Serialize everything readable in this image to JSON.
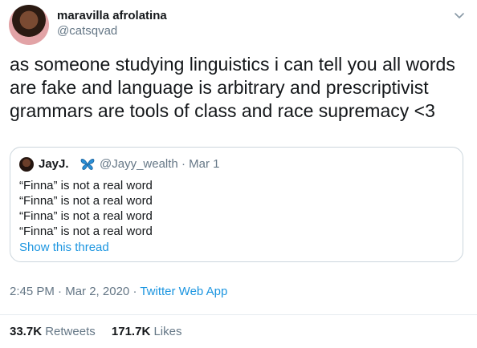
{
  "author": {
    "display_name": "maravilla afrolatina",
    "handle": "@catsqvad"
  },
  "tweet": {
    "text": "as someone studying linguistics i can tell you all words are fake and language is arbitrary and prescriptivist grammars are tools of class and race supremacy <3"
  },
  "quoted": {
    "display_name": "JayJ.",
    "badge_icon": "butterfly-icon",
    "handle": "@Jayy_wealth",
    "separator": "·",
    "date": "Mar 1",
    "lines": [
      "“Finna” is not a real word",
      "“Finna” is not a real word",
      "“Finna” is not a real word",
      "“Finna” is not a real word"
    ],
    "show_thread": "Show this thread"
  },
  "meta": {
    "time": "2:45 PM",
    "sep1": "·",
    "date": "Mar 2, 2020",
    "sep2": "·",
    "app": "Twitter Web App"
  },
  "stats": {
    "retweets_count": "33.7K",
    "retweets_label": "Retweets",
    "likes_count": "171.7K",
    "likes_label": "Likes"
  },
  "colors": {
    "link_blue": "#1b95e0",
    "muted_gray": "#657786",
    "border": "#ccd6dd",
    "butterfly_blue": "#2a8fd6"
  }
}
